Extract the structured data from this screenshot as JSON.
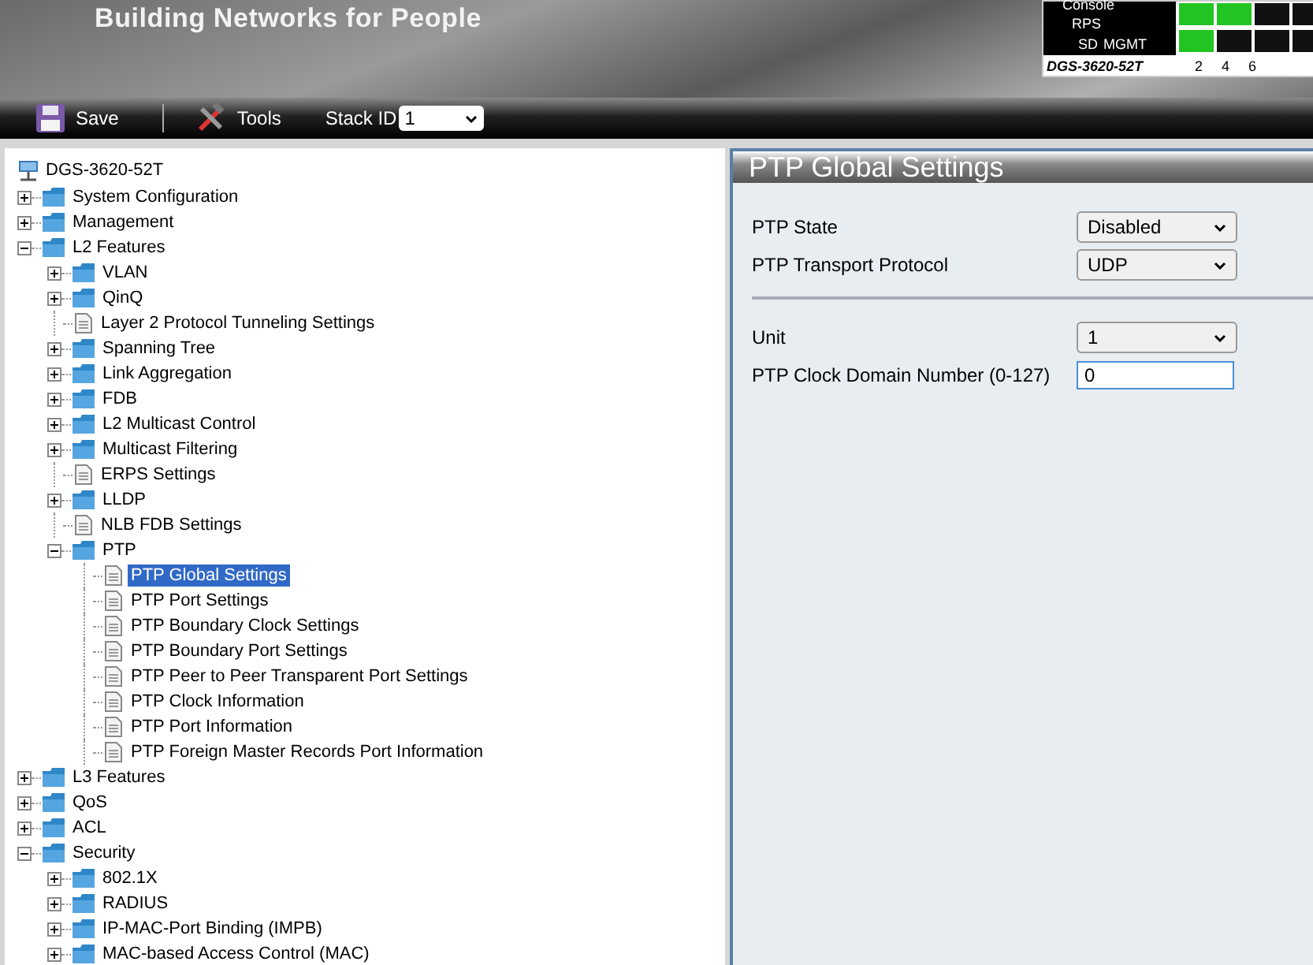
{
  "header": {
    "tagline": "Building Networks for People",
    "device": {
      "labels": [
        "Console",
        "RPS",
        "SD",
        "MGMT"
      ],
      "model": "DGS-3620-52T",
      "ports": [
        "2",
        "4",
        "6"
      ]
    }
  },
  "toolbar": {
    "items": [
      {
        "kind": "save",
        "label": "Save"
      },
      {
        "kind": "tools",
        "label": "Tools"
      }
    ],
    "stack_id": {
      "label": "Stack ID",
      "value": "1"
    }
  },
  "tree": {
    "root": "DGS-3620-52T",
    "items": [
      {
        "label": "System Configuration",
        "kind": "folder",
        "expanded": false,
        "selected": false
      },
      {
        "label": "Management",
        "kind": "folder",
        "expanded": false,
        "selected": false
      },
      {
        "label": "L2 Features",
        "kind": "folder",
        "expanded": true,
        "selected": false,
        "children": [
          {
            "label": "VLAN",
            "kind": "folder",
            "expanded": false,
            "selected": false
          },
          {
            "label": "QinQ",
            "kind": "folder",
            "expanded": false,
            "selected": false
          },
          {
            "label": "Layer 2 Protocol Tunneling Settings",
            "kind": "page",
            "selected": false
          },
          {
            "label": "Spanning Tree",
            "kind": "folder",
            "expanded": false,
            "selected": false
          },
          {
            "label": "Link Aggregation",
            "kind": "folder",
            "expanded": false,
            "selected": false
          },
          {
            "label": "FDB",
            "kind": "folder",
            "expanded": false,
            "selected": false
          },
          {
            "label": "L2 Multicast Control",
            "kind": "folder",
            "expanded": false,
            "selected": false
          },
          {
            "label": "Multicast Filtering",
            "kind": "folder",
            "expanded": false,
            "selected": false
          },
          {
            "label": "ERPS Settings",
            "kind": "page",
            "selected": false
          },
          {
            "label": "LLDP",
            "kind": "folder",
            "expanded": false,
            "selected": false
          },
          {
            "label": "NLB FDB Settings",
            "kind": "page",
            "selected": false
          },
          {
            "label": "PTP",
            "kind": "folder",
            "expanded": true,
            "selected": false,
            "children": [
              {
                "label": "PTP Global Settings",
                "kind": "page",
                "selected": true
              },
              {
                "label": "PTP Port Settings",
                "kind": "page",
                "selected": false
              },
              {
                "label": "PTP Boundary Clock Settings",
                "kind": "page",
                "selected": false
              },
              {
                "label": "PTP Boundary Port Settings",
                "kind": "page",
                "selected": false
              },
              {
                "label": "PTP Peer to Peer Transparent Port Settings",
                "kind": "page",
                "selected": false
              },
              {
                "label": "PTP Clock Information",
                "kind": "page",
                "selected": false
              },
              {
                "label": "PTP Port Information",
                "kind": "page",
                "selected": false
              },
              {
                "label": "PTP Foreign Master Records Port Information",
                "kind": "page",
                "selected": false
              }
            ]
          }
        ]
      },
      {
        "label": "L3 Features",
        "kind": "folder",
        "expanded": false,
        "selected": false
      },
      {
        "label": "QoS",
        "kind": "folder",
        "expanded": false,
        "selected": false
      },
      {
        "label": "ACL",
        "kind": "folder",
        "expanded": false,
        "selected": false
      },
      {
        "label": "Security",
        "kind": "folder",
        "expanded": true,
        "selected": false,
        "children": [
          {
            "label": "802.1X",
            "kind": "folder",
            "expanded": false,
            "selected": false
          },
          {
            "label": "RADIUS",
            "kind": "folder",
            "expanded": false,
            "selected": false
          },
          {
            "label": "IP-MAC-Port Binding (IMPB)",
            "kind": "folder",
            "expanded": false,
            "selected": false
          },
          {
            "label": "MAC-based Access Control (MAC)",
            "kind": "folder",
            "expanded": false,
            "selected": false
          }
        ]
      }
    ]
  },
  "panel": {
    "title": "PTP Global Settings",
    "groups": [
      [
        {
          "label": "PTP State",
          "kind": "select",
          "value": "Disabled"
        },
        {
          "label": "PTP Transport Protocol",
          "kind": "select",
          "value": "UDP"
        }
      ],
      [
        {
          "label": "Unit",
          "kind": "select",
          "value": "1"
        },
        {
          "label": "PTP Clock Domain Number (0-127)",
          "kind": "text",
          "value": "0"
        }
      ]
    ]
  }
}
